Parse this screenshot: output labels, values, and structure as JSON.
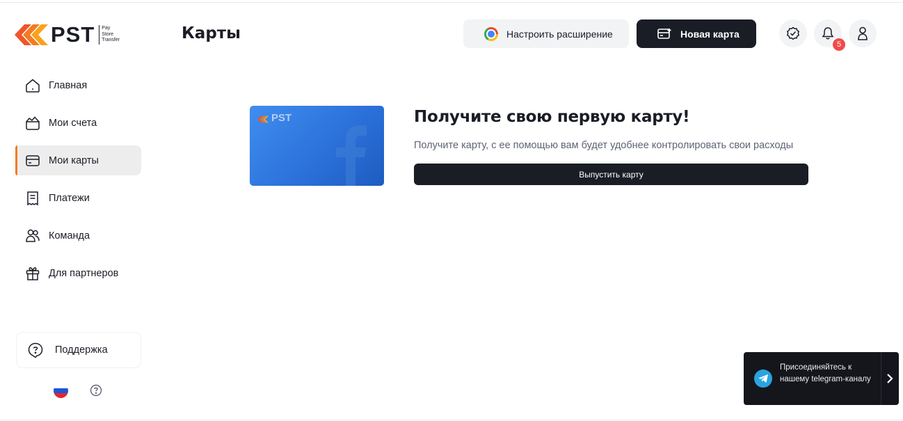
{
  "brand": {
    "name": "PST",
    "tagline": [
      "Pay",
      "Store",
      "Transfer"
    ]
  },
  "header": {
    "title": "Карты",
    "extension_button": "Настроить расширение",
    "new_card_button": "Новая карта",
    "notifications_count": "5"
  },
  "sidebar": {
    "items": [
      {
        "label": "Главная",
        "icon": "home-icon"
      },
      {
        "label": "Мои счета",
        "icon": "wallet-icon"
      },
      {
        "label": "Мои карты",
        "icon": "card-icon",
        "active": true
      },
      {
        "label": "Платежи",
        "icon": "receipt-icon"
      },
      {
        "label": "Команда",
        "icon": "team-icon"
      },
      {
        "label": "Для партнеров",
        "icon": "gift-icon"
      }
    ],
    "support_label": "Поддержка",
    "language": "ru"
  },
  "main": {
    "card_brand": "PST",
    "headline": "Получите свою первую карту!",
    "subline": "Получите карту, с ее помощью вам будет удобнее контролировать свои расходы",
    "issue_button": "Выпустить карту"
  },
  "telegram_widget": {
    "text": "Присоединяйтесь к нашему telegram-каналу"
  },
  "colors": {
    "accent": "#f47b20",
    "dark": "#1b1d26",
    "badge": "#f04c4c",
    "telegram": "#2aa3e0"
  }
}
